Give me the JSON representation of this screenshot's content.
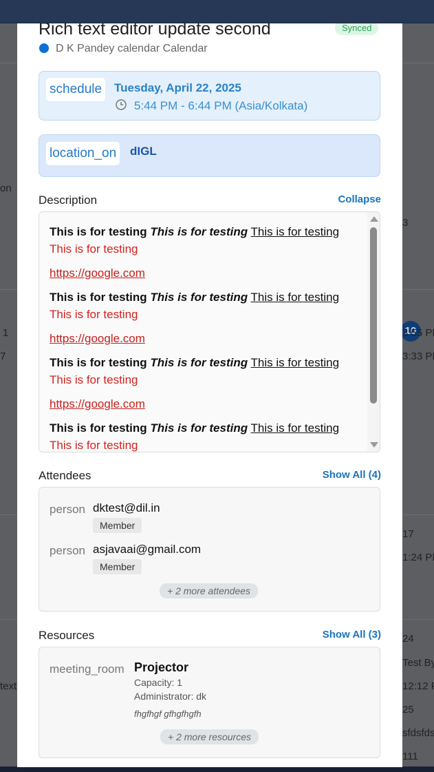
{
  "event": {
    "title": "Rich text editor update second",
    "sync_status": "Synced",
    "calendar_name": "D K Pandey calendar Calendar",
    "calendar_color": "#0a72d6",
    "date_icon": "schedule",
    "date": "Tuesday, April 22, 2025",
    "time": "5:44 PM - 6:44 PM (Asia/Kolkata)",
    "location_icon": "location_on",
    "location": "dIGL"
  },
  "description": {
    "heading": "Description",
    "toggle_label": "Collapse",
    "blocks": [
      {
        "bold": "This is for testing",
        "bold_italic": "This is for testing",
        "underline": "This is for testing",
        "red": "This is for testing",
        "link": "https://google.com"
      },
      {
        "bold": "This is for testing",
        "bold_italic": "This is for testing",
        "underline": "This is for testing",
        "red": "This is for testing",
        "link": "https://google.com"
      },
      {
        "bold": "This is for testing",
        "bold_italic": "This is for testing",
        "underline": "This is for testing",
        "red": "This is for testing",
        "link": "https://google.com"
      },
      {
        "bold": "This is for testing",
        "bold_italic": "This is for testing",
        "underline": "This is for testing",
        "red": "This is for testing"
      }
    ]
  },
  "attendees": {
    "heading": "Attendees",
    "show_all_label": "Show All (4)",
    "list": [
      {
        "icon": "person",
        "email": "dktest@dil.in",
        "role": "Member"
      },
      {
        "icon": "person",
        "email": "asjavaai@gmail.com",
        "role": "Member"
      }
    ],
    "more_label": "+ 2 more attendees"
  },
  "resources": {
    "heading": "Resources",
    "show_all_label": "Show All (3)",
    "item": {
      "icon": "meeting_room",
      "name": "Projector",
      "capacity": "Capacity: 1",
      "administrator": "Administrator: dk",
      "notes": "fhgfhgf gfhgfhgfh"
    },
    "more_label": "+ 2 more resources"
  },
  "background": {
    "left_texts": [
      "on",
      "1",
      "7",
      "text"
    ],
    "right_texts": [
      "3",
      "3:55 PI",
      "3:33 PI",
      "17",
      "1:24 PI",
      "24",
      "Test By",
      "12:12 P",
      "25",
      "sfdsfds",
      "111"
    ],
    "badge": "10"
  },
  "colors": {
    "accent": "#1a74bf",
    "synced_bg": "#dcf6e4",
    "synced_text": "#2f9e55",
    "description_red": "#d1231f"
  }
}
